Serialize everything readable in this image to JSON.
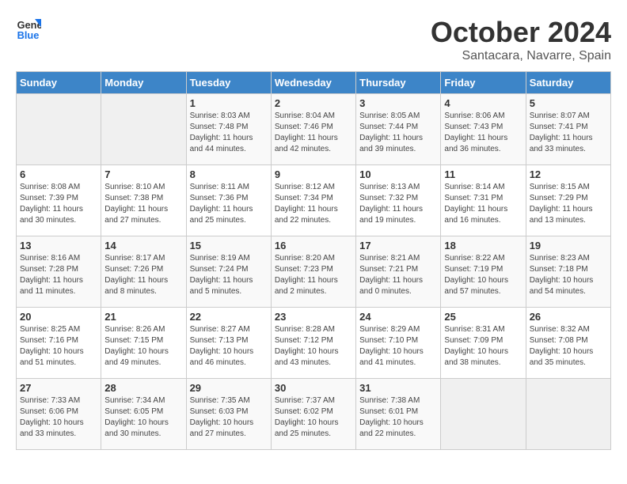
{
  "header": {
    "logo_general": "General",
    "logo_blue": "Blue",
    "month": "October 2024",
    "location": "Santacara, Navarre, Spain"
  },
  "weekdays": [
    "Sunday",
    "Monday",
    "Tuesday",
    "Wednesday",
    "Thursday",
    "Friday",
    "Saturday"
  ],
  "weeks": [
    [
      {
        "day": "",
        "sunrise": "",
        "sunset": "",
        "daylight": ""
      },
      {
        "day": "",
        "sunrise": "",
        "sunset": "",
        "daylight": ""
      },
      {
        "day": "1",
        "sunrise": "Sunrise: 8:03 AM",
        "sunset": "Sunset: 7:48 PM",
        "daylight": "Daylight: 11 hours and 44 minutes."
      },
      {
        "day": "2",
        "sunrise": "Sunrise: 8:04 AM",
        "sunset": "Sunset: 7:46 PM",
        "daylight": "Daylight: 11 hours and 42 minutes."
      },
      {
        "day": "3",
        "sunrise": "Sunrise: 8:05 AM",
        "sunset": "Sunset: 7:44 PM",
        "daylight": "Daylight: 11 hours and 39 minutes."
      },
      {
        "day": "4",
        "sunrise": "Sunrise: 8:06 AM",
        "sunset": "Sunset: 7:43 PM",
        "daylight": "Daylight: 11 hours and 36 minutes."
      },
      {
        "day": "5",
        "sunrise": "Sunrise: 8:07 AM",
        "sunset": "Sunset: 7:41 PM",
        "daylight": "Daylight: 11 hours and 33 minutes."
      }
    ],
    [
      {
        "day": "6",
        "sunrise": "Sunrise: 8:08 AM",
        "sunset": "Sunset: 7:39 PM",
        "daylight": "Daylight: 11 hours and 30 minutes."
      },
      {
        "day": "7",
        "sunrise": "Sunrise: 8:10 AM",
        "sunset": "Sunset: 7:38 PM",
        "daylight": "Daylight: 11 hours and 27 minutes."
      },
      {
        "day": "8",
        "sunrise": "Sunrise: 8:11 AM",
        "sunset": "Sunset: 7:36 PM",
        "daylight": "Daylight: 11 hours and 25 minutes."
      },
      {
        "day": "9",
        "sunrise": "Sunrise: 8:12 AM",
        "sunset": "Sunset: 7:34 PM",
        "daylight": "Daylight: 11 hours and 22 minutes."
      },
      {
        "day": "10",
        "sunrise": "Sunrise: 8:13 AM",
        "sunset": "Sunset: 7:32 PM",
        "daylight": "Daylight: 11 hours and 19 minutes."
      },
      {
        "day": "11",
        "sunrise": "Sunrise: 8:14 AM",
        "sunset": "Sunset: 7:31 PM",
        "daylight": "Daylight: 11 hours and 16 minutes."
      },
      {
        "day": "12",
        "sunrise": "Sunrise: 8:15 AM",
        "sunset": "Sunset: 7:29 PM",
        "daylight": "Daylight: 11 hours and 13 minutes."
      }
    ],
    [
      {
        "day": "13",
        "sunrise": "Sunrise: 8:16 AM",
        "sunset": "Sunset: 7:28 PM",
        "daylight": "Daylight: 11 hours and 11 minutes."
      },
      {
        "day": "14",
        "sunrise": "Sunrise: 8:17 AM",
        "sunset": "Sunset: 7:26 PM",
        "daylight": "Daylight: 11 hours and 8 minutes."
      },
      {
        "day": "15",
        "sunrise": "Sunrise: 8:19 AM",
        "sunset": "Sunset: 7:24 PM",
        "daylight": "Daylight: 11 hours and 5 minutes."
      },
      {
        "day": "16",
        "sunrise": "Sunrise: 8:20 AM",
        "sunset": "Sunset: 7:23 PM",
        "daylight": "Daylight: 11 hours and 2 minutes."
      },
      {
        "day": "17",
        "sunrise": "Sunrise: 8:21 AM",
        "sunset": "Sunset: 7:21 PM",
        "daylight": "Daylight: 11 hours and 0 minutes."
      },
      {
        "day": "18",
        "sunrise": "Sunrise: 8:22 AM",
        "sunset": "Sunset: 7:19 PM",
        "daylight": "Daylight: 10 hours and 57 minutes."
      },
      {
        "day": "19",
        "sunrise": "Sunrise: 8:23 AM",
        "sunset": "Sunset: 7:18 PM",
        "daylight": "Daylight: 10 hours and 54 minutes."
      }
    ],
    [
      {
        "day": "20",
        "sunrise": "Sunrise: 8:25 AM",
        "sunset": "Sunset: 7:16 PM",
        "daylight": "Daylight: 10 hours and 51 minutes."
      },
      {
        "day": "21",
        "sunrise": "Sunrise: 8:26 AM",
        "sunset": "Sunset: 7:15 PM",
        "daylight": "Daylight: 10 hours and 49 minutes."
      },
      {
        "day": "22",
        "sunrise": "Sunrise: 8:27 AM",
        "sunset": "Sunset: 7:13 PM",
        "daylight": "Daylight: 10 hours and 46 minutes."
      },
      {
        "day": "23",
        "sunrise": "Sunrise: 8:28 AM",
        "sunset": "Sunset: 7:12 PM",
        "daylight": "Daylight: 10 hours and 43 minutes."
      },
      {
        "day": "24",
        "sunrise": "Sunrise: 8:29 AM",
        "sunset": "Sunset: 7:10 PM",
        "daylight": "Daylight: 10 hours and 41 minutes."
      },
      {
        "day": "25",
        "sunrise": "Sunrise: 8:31 AM",
        "sunset": "Sunset: 7:09 PM",
        "daylight": "Daylight: 10 hours and 38 minutes."
      },
      {
        "day": "26",
        "sunrise": "Sunrise: 8:32 AM",
        "sunset": "Sunset: 7:08 PM",
        "daylight": "Daylight: 10 hours and 35 minutes."
      }
    ],
    [
      {
        "day": "27",
        "sunrise": "Sunrise: 7:33 AM",
        "sunset": "Sunset: 6:06 PM",
        "daylight": "Daylight: 10 hours and 33 minutes."
      },
      {
        "day": "28",
        "sunrise": "Sunrise: 7:34 AM",
        "sunset": "Sunset: 6:05 PM",
        "daylight": "Daylight: 10 hours and 30 minutes."
      },
      {
        "day": "29",
        "sunrise": "Sunrise: 7:35 AM",
        "sunset": "Sunset: 6:03 PM",
        "daylight": "Daylight: 10 hours and 27 minutes."
      },
      {
        "day": "30",
        "sunrise": "Sunrise: 7:37 AM",
        "sunset": "Sunset: 6:02 PM",
        "daylight": "Daylight: 10 hours and 25 minutes."
      },
      {
        "day": "31",
        "sunrise": "Sunrise: 7:38 AM",
        "sunset": "Sunset: 6:01 PM",
        "daylight": "Daylight: 10 hours and 22 minutes."
      },
      {
        "day": "",
        "sunrise": "",
        "sunset": "",
        "daylight": ""
      },
      {
        "day": "",
        "sunrise": "",
        "sunset": "",
        "daylight": ""
      }
    ]
  ]
}
